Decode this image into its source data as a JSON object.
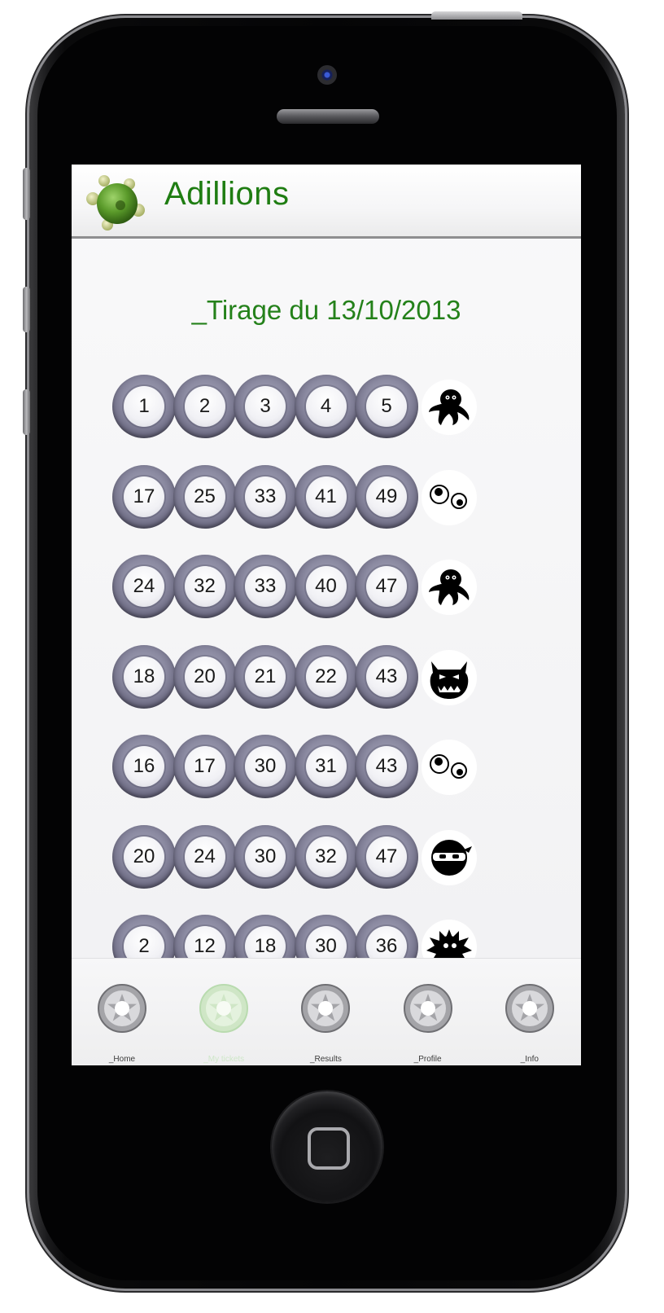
{
  "app": {
    "title": "Adillions",
    "accent_color": "#1f7d12",
    "logo_icon": "green-spiky-ball-logo"
  },
  "draw": {
    "title": "_Tirage du 13/10/2013"
  },
  "tickets": [
    {
      "numbers": [
        "1",
        "2",
        "3",
        "4",
        "5"
      ],
      "mascot": "octopus-mascot-icon"
    },
    {
      "numbers": [
        "17",
        "25",
        "33",
        "41",
        "49"
      ],
      "mascot": "eyes-mascot-icon"
    },
    {
      "numbers": [
        "24",
        "32",
        "33",
        "40",
        "47"
      ],
      "mascot": "octopus-mascot-icon"
    },
    {
      "numbers": [
        "18",
        "20",
        "21",
        "22",
        "43"
      ],
      "mascot": "horned-monster-mascot-icon"
    },
    {
      "numbers": [
        "16",
        "17",
        "30",
        "31",
        "43"
      ],
      "mascot": "eyes-mascot-icon"
    },
    {
      "numbers": [
        "20",
        "24",
        "30",
        "32",
        "47"
      ],
      "mascot": "ninja-mascot-icon"
    },
    {
      "numbers": [
        "2",
        "12",
        "18",
        "30",
        "36"
      ],
      "mascot": "spiky-blob-mascot-icon"
    }
  ],
  "tab_bar": {
    "tabs": [
      {
        "label": "_Home",
        "icon": "home-tab-icon",
        "active": false
      },
      {
        "label": "_My tickets",
        "icon": "tickets-tab-icon",
        "active": true
      },
      {
        "label": "_Results",
        "icon": "results-tab-icon",
        "active": false
      },
      {
        "label": "_Profile",
        "icon": "profile-tab-icon",
        "active": false
      },
      {
        "label": "_Info",
        "icon": "info-tab-icon",
        "active": false
      }
    ]
  }
}
